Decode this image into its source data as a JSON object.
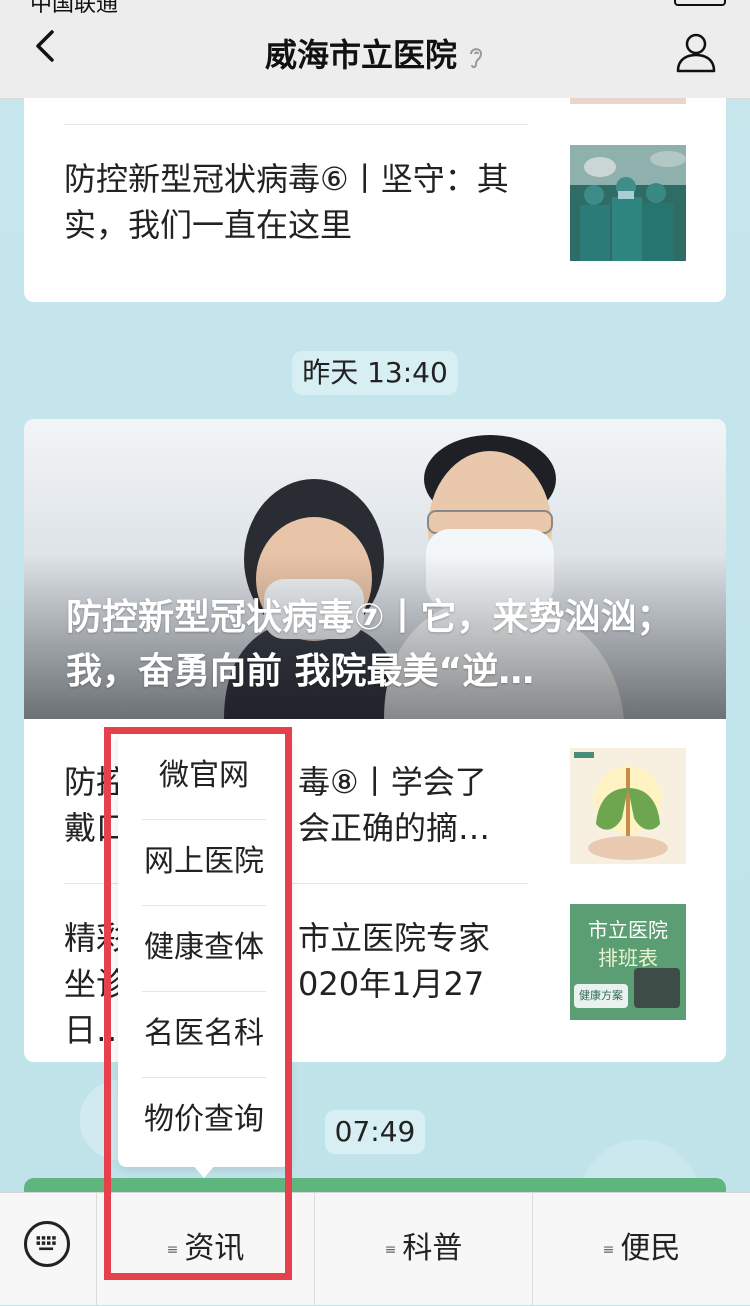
{
  "header": {
    "title": "威海市立医院",
    "status_text": "中国联通"
  },
  "feed": {
    "card1": {
      "article": {
        "title": "防控新型冠状病毒⑥丨坚守：其实，我们一直在这里"
      }
    },
    "time1": "昨天 13:40",
    "card2": {
      "hero_title": "防控新型冠状病毒⑦丨它，来势汹汹；我，奋勇向前 我院最美“逆…",
      "articles": [
        {
          "title_left": "防控",
          "title_right": "毒⑧丨学会了",
          "line2_left": "戴口",
          "line2_right": "会正确的摘…"
        },
        {
          "title_left": "精彩",
          "title_right": "市立医院专家",
          "line2_left": "坐诊",
          "line2_right": "020年1月27日…"
        }
      ],
      "thumb2_text": [
        "市立医院",
        "排班表",
        "健康方案"
      ]
    },
    "time2": "07:49"
  },
  "popup_menu": {
    "items": [
      "微官网",
      "网上医院",
      "健康查体",
      "名医名科",
      "物价查询"
    ]
  },
  "bottom_menu": {
    "tabs": [
      "资讯",
      "科普",
      "便民"
    ]
  },
  "colors": {
    "highlight": "#e5404b",
    "background": "#bfe3ea"
  }
}
